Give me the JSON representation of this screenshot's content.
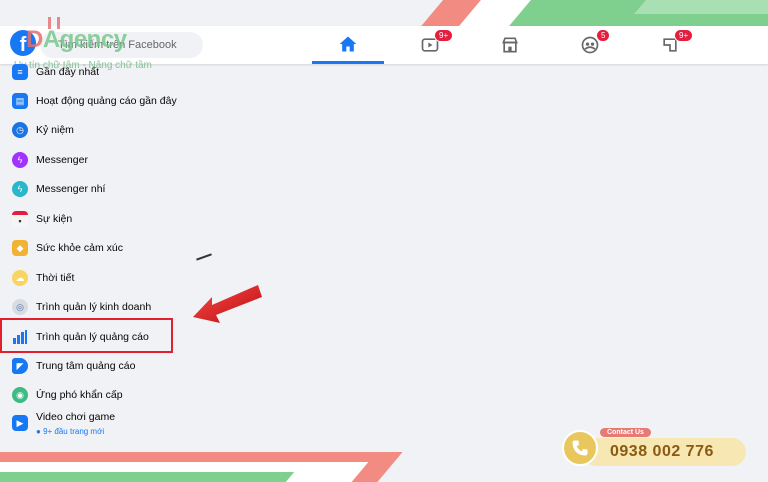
{
  "watermark": {
    "brand_prefix": "D",
    "brand_rest": "Agency",
    "tagline": "Uy tín chữ tâm - Nâng chữ tầm"
  },
  "topbar": {
    "search_placeholder": "Tìm kiếm trên Facebook",
    "tabs": [
      {
        "icon": "home-icon",
        "badge": ""
      },
      {
        "icon": "watch-icon",
        "badge": "9+"
      },
      {
        "icon": "marketplace-icon",
        "badge": ""
      },
      {
        "icon": "groups-icon",
        "badge": "5"
      },
      {
        "icon": "gaming-icon",
        "badge": "9+"
      }
    ]
  },
  "menu": {
    "items": [
      {
        "label": "Gần đây nhất",
        "icon": "recent-icon"
      },
      {
        "label": "Hoạt động quảng cáo gần đây",
        "icon": "ad-activity-icon"
      },
      {
        "label": "Kỷ niệm",
        "icon": "memories-icon"
      },
      {
        "label": "Messenger",
        "icon": "messenger-icon"
      },
      {
        "label": "Messenger nhí",
        "icon": "messenger-kids-icon"
      },
      {
        "label": "Sự kiện",
        "icon": "events-icon"
      },
      {
        "label": "Sức khỏe cảm xúc",
        "icon": "emotional-health-icon"
      },
      {
        "label": "Thời tiết",
        "icon": "weather-icon"
      },
      {
        "label": "Trình quản lý kinh doanh",
        "icon": "business-manager-icon"
      },
      {
        "label": "Trình quản lý quảng cáo",
        "icon": "ads-manager-icon"
      },
      {
        "label": "Trung tâm quảng cáo",
        "icon": "ad-center-icon"
      },
      {
        "label": "Ứng phó khẩn cấp",
        "icon": "crisis-response-icon"
      },
      {
        "label": "Video chơi game",
        "icon": "gaming-video-icon",
        "sub": "9+ đầu trang mới"
      }
    ],
    "highlighted_index": 9
  },
  "contact": {
    "tag": "Contact Us",
    "phone": "0938 002 776"
  },
  "colors": {
    "facebook_blue": "#1877f2",
    "highlight_red": "#e0202c",
    "stripe_red": "#f28b82",
    "stripe_green": "#7fd08f"
  }
}
